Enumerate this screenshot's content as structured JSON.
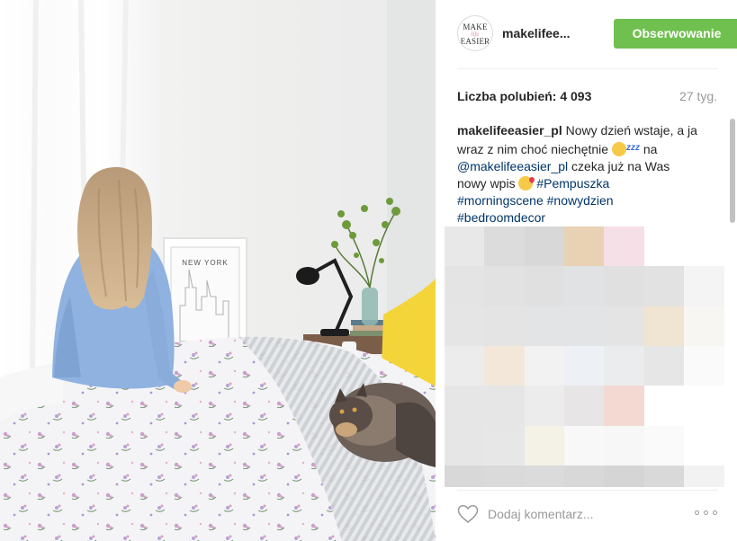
{
  "post": {
    "username": "makelifee...",
    "avatar_text": {
      "line1": "MAKE",
      "line2": "life",
      "line3": "EASIER"
    },
    "follow_label": "Obserwowanie",
    "likes": "Liczba polubień: 4 093",
    "age": "27 tyg.",
    "caption": {
      "author": "makelifeeasier_pl",
      "text1": " Nowy dzień wstaje, a ja wraz z nim choć niechętnie ",
      "zzz": "zzz",
      "text2": " na ",
      "mention": "@makelifeeasier_pl",
      "text3": " czeka już na Was nowy wpis ",
      "hashtags": [
        "#Pempuszka",
        "#morningscene",
        "#nowydzien",
        "#bedroomdecor"
      ]
    },
    "comment_placeholder": "Dodaj komentarz...",
    "photo_text": "NEW YORK"
  },
  "colors": {
    "follow_button": "#70c050",
    "link": "#003569"
  },
  "icons": {
    "like": "heart-icon",
    "more": "more-options-icon",
    "emoji1": "sleeping-face-emoji",
    "emoji2": "kissing-face-emoji"
  },
  "mosaic": [
    [
      "#e8e8e8",
      "#dcdcdc",
      "#d8d8d8",
      "#e9d2b4",
      "#f6e0e8",
      "#ffffff",
      "#ffffff"
    ],
    [
      "#e4e4e4",
      "#e2e2e2",
      "#e0e0e0",
      "#e1e2e4",
      "#e0e0e0",
      "#e2e2e2",
      "#f4f4f4"
    ],
    [
      "#e5e5e5",
      "#e4e4e4",
      "#e3e4e6",
      "#e2e4e6",
      "#e4e4e4",
      "#f0e4d2",
      "#f8f6f2"
    ],
    [
      "#ececec",
      "#f2e7d9",
      "#f2f2f2",
      "#edf0f5",
      "#eaeced",
      "#e6e6e6",
      "#fafafa"
    ],
    [
      "#e6e6e6",
      "#e6e6e6",
      "#ececec",
      "#e8e5e6",
      "#f4d9d3",
      "#ffffff",
      "#ffffff"
    ],
    [
      "#e6e6e6",
      "#e7e7e7",
      "#f4f1e6",
      "#f8f8f8",
      "#f7f7f7",
      "#fafafa",
      "#ffffff"
    ],
    [
      "#d8d8d8",
      "#dadada",
      "#dbdbdb",
      "#d8d8d8",
      "#d5d5d5",
      "#d9d9d9",
      "#f2f2f2"
    ]
  ]
}
